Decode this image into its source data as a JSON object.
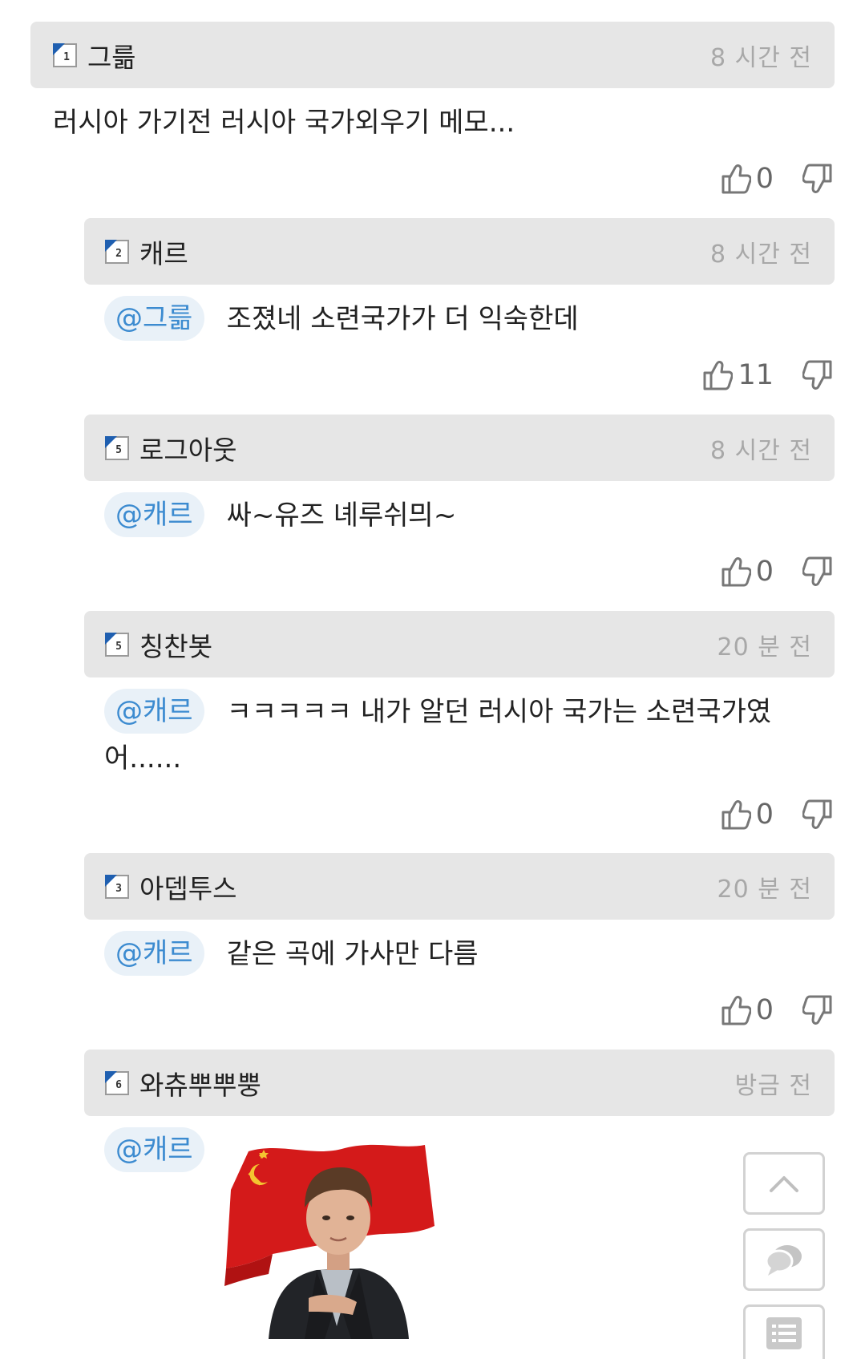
{
  "comments": [
    {
      "level": "1",
      "nickname": "그륾",
      "time": "8 시간 전",
      "mention": "",
      "text": "러시아 가기전 러시아 국가외우기 메모...",
      "likes": "0"
    },
    {
      "level": "2",
      "nickname": "캐르",
      "time": "8 시간 전",
      "mention": "@그륾",
      "text": "조졌네 소련국가가 더 익숙한데",
      "likes": "11"
    },
    {
      "level": "5",
      "nickname": "로그아웃",
      "time": "8 시간 전",
      "mention": "@캐르",
      "text": "싸~유즈 녜루쉬믜~",
      "likes": "0"
    },
    {
      "level": "5",
      "nickname": "칭찬봇",
      "time": "20 분 전",
      "mention": "@캐르",
      "text_line1": "ㅋㅋㅋㅋㅋ 내가 알던 러시아 국가는 소련국가였",
      "text_line2": "어......",
      "likes": "0"
    },
    {
      "level": "3",
      "nickname": "아뎁투스",
      "time": "20 분 전",
      "mention": "@캐르",
      "text": "같은 곡에 가사만 다름",
      "likes": "0"
    },
    {
      "level": "6",
      "nickname": "와츄뿌뿌뿡",
      "time": "방금 전",
      "mention": "@캐르",
      "image": "boy-with-soviet-flag"
    }
  ],
  "colors": {
    "header_bg": "#e6e6e6",
    "mention_text": "#3c8bd0",
    "mention_bg": "#e9f1f8",
    "level_badge": "#1f5fb0",
    "flag_red": "#d41a1a"
  },
  "floating_buttons": [
    "scroll-top-icon",
    "comment-icon",
    "list-icon"
  ]
}
